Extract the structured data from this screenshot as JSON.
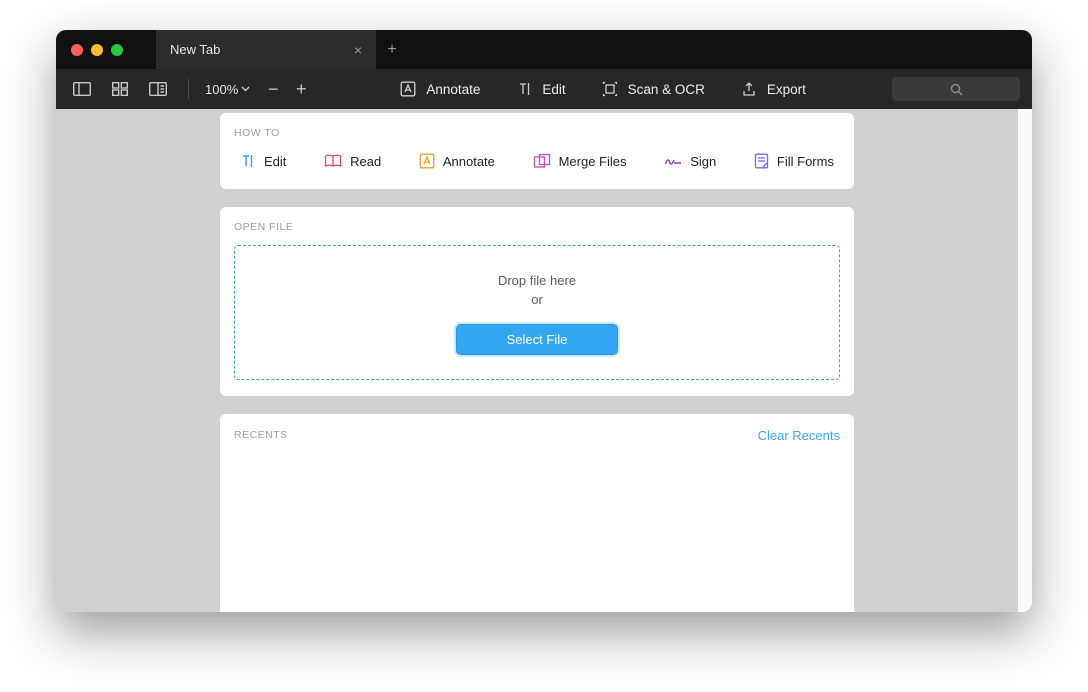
{
  "tab": {
    "title": "New Tab"
  },
  "toolbar": {
    "zoom_value": "100%",
    "actions": {
      "annotate": "Annotate",
      "edit": "Edit",
      "scan_ocr": "Scan & OCR",
      "export": "Export"
    }
  },
  "howto": {
    "label": "HOW TO",
    "items": {
      "edit": "Edit",
      "read": "Read",
      "annotate": "Annotate",
      "merge": "Merge Files",
      "sign": "Sign",
      "fill": "Fill Forms"
    }
  },
  "openfile": {
    "label": "OPEN FILE",
    "drop_line1": "Drop file here",
    "drop_line2": "or",
    "button": "Select File"
  },
  "recents": {
    "label": "RECENTS",
    "clear": "Clear Recents"
  }
}
